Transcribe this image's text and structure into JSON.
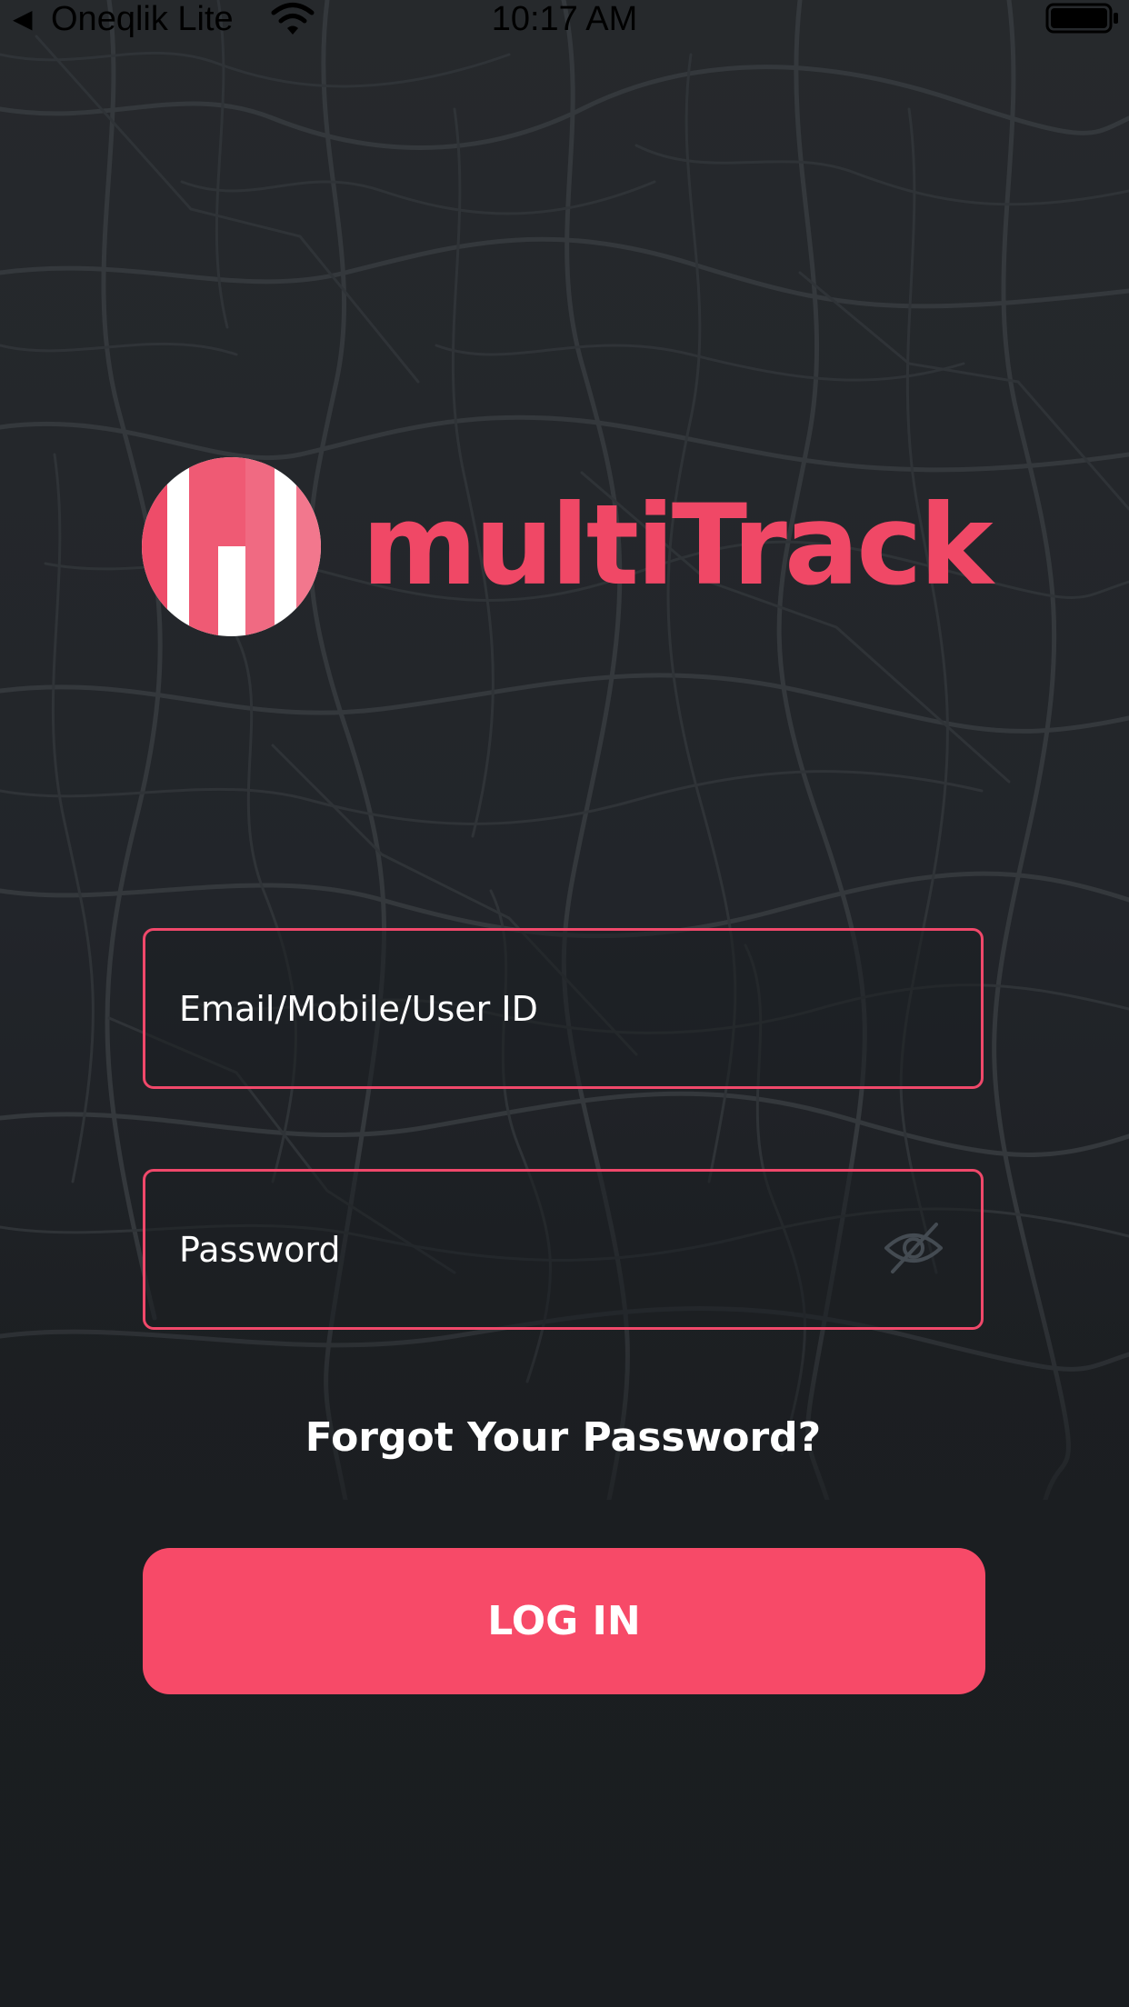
{
  "status_bar": {
    "back_glyph": "◀",
    "carrier": "Oneqlik Lite",
    "time": "10:17 AM",
    "icons": [
      "back-triangle-icon",
      "wifi-icon",
      "battery-icon"
    ]
  },
  "brand": {
    "name": "multiTrack",
    "logo_icon": "multitrack-logo-icon",
    "color": "#f04866"
  },
  "login_form": {
    "email_placeholder": "Email/Mobile/User ID",
    "email_value": "",
    "password_placeholder": "Password",
    "password_value": "",
    "password_toggle_icon": "eye-slash-icon",
    "forgot_password_label": "Forgot Your Password?",
    "login_label": "LOG IN"
  },
  "colors": {
    "accent": "#f74a68",
    "field_border": "#f0486a",
    "background": "#1b1e21"
  }
}
